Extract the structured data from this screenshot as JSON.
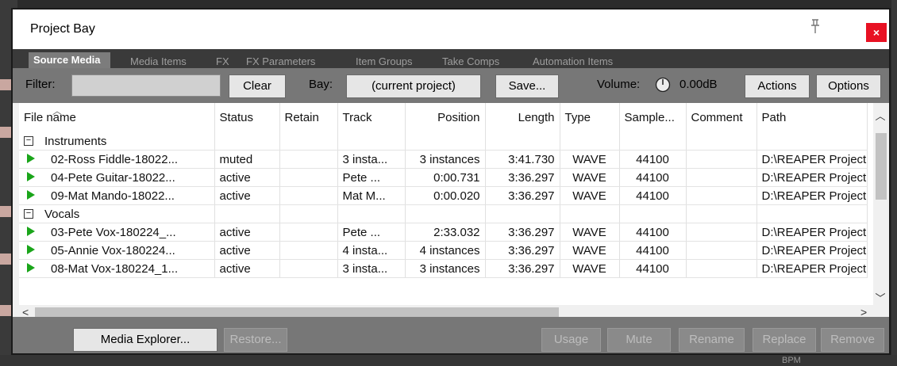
{
  "window": {
    "title": "Project Bay",
    "close_label": "×"
  },
  "tabs": [
    "Source Media",
    "Media Items",
    "FX",
    "FX Parameters",
    "Item Groups",
    "Take Comps",
    "Automation Items"
  ],
  "toolbar": {
    "filter_label": "Filter:",
    "filter_value": "",
    "clear_label": "Clear",
    "bay_label": "Bay:",
    "bay_value": "(current project)",
    "save_label": "Save...",
    "volume_label": "Volume:",
    "volume_value": "0.00dB",
    "actions_label": "Actions",
    "options_label": "Options"
  },
  "table": {
    "columns": [
      "File name",
      "Status",
      "Retain",
      "Track",
      "Position",
      "Length",
      "Type",
      "Sample...",
      "Comment",
      "Path"
    ],
    "groups": [
      {
        "name": "Instruments",
        "toggle": "−",
        "rows": [
          {
            "file": "02-Ross Fiddle-18022...",
            "status": "muted",
            "retain": "",
            "track": "3 insta...",
            "position": "3 instances",
            "length": "3:41.730",
            "type": "WAVE",
            "samplerate": "44100",
            "comment": "",
            "path": "D:\\REAPER Project"
          },
          {
            "file": "04-Pete Guitar-18022...",
            "status": "active",
            "retain": "",
            "track": "Pete ...",
            "position": "0:00.731",
            "length": "3:36.297",
            "type": "WAVE",
            "samplerate": "44100",
            "comment": "",
            "path": "D:\\REAPER Project"
          },
          {
            "file": "09-Mat Mando-18022...",
            "status": "active",
            "retain": "",
            "track": "Mat M...",
            "position": "0:00.020",
            "length": "3:36.297",
            "type": "WAVE",
            "samplerate": "44100",
            "comment": "",
            "path": "D:\\REAPER Project"
          }
        ]
      },
      {
        "name": "Vocals",
        "toggle": "−",
        "rows": [
          {
            "file": "03-Pete Vox-180224_...",
            "status": "active",
            "retain": "",
            "track": "Pete ...",
            "position": "2:33.032",
            "length": "3:36.297",
            "type": "WAVE",
            "samplerate": "44100",
            "comment": "",
            "path": "D:\\REAPER Project"
          },
          {
            "file": "05-Annie Vox-180224...",
            "status": "active",
            "retain": "",
            "track": "4 insta...",
            "position": "4 instances",
            "length": "3:36.297",
            "type": "WAVE",
            "samplerate": "44100",
            "comment": "",
            "path": "D:\\REAPER Project"
          },
          {
            "file": "08-Mat Vox-180224_1...",
            "status": "active",
            "retain": "",
            "track": "3 insta...",
            "position": "3 instances",
            "length": "3:36.297",
            "type": "WAVE",
            "samplerate": "44100",
            "comment": "",
            "path": "D:\\REAPER Project"
          }
        ]
      }
    ]
  },
  "bottombar": {
    "media_explorer_label": "Media Explorer...",
    "restore_label": "Restore...",
    "usage_label": "Usage",
    "mute_label": "Mute",
    "rename_label": "Rename",
    "replace_label": "Replace",
    "remove_label": "Remove"
  },
  "background": {
    "bottom_text": "BPM"
  },
  "colors": {
    "play_icon": "#1aa51a",
    "close_button": "#e81123",
    "toolbar": "#777777",
    "tabbar": "#3a3a3a"
  }
}
